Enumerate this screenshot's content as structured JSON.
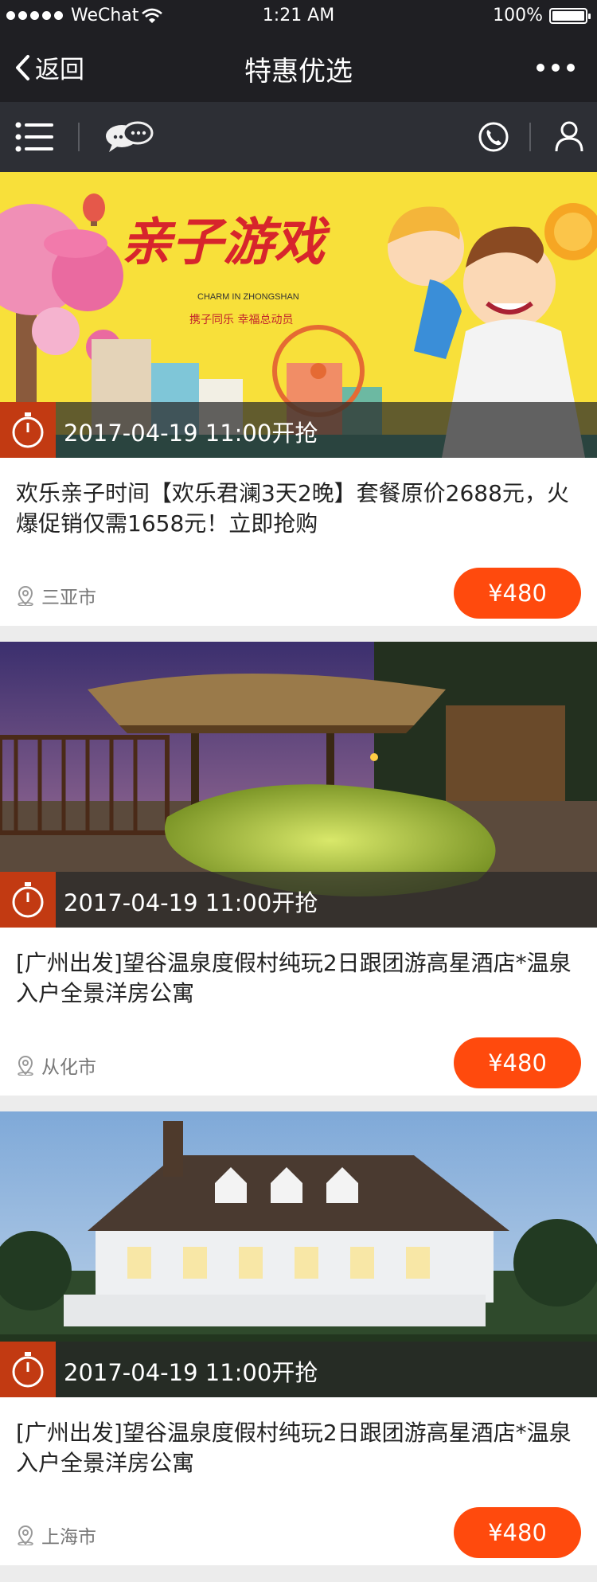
{
  "status_bar": {
    "carrier": "WeChat",
    "time": "1:21 AM",
    "battery": "100%"
  },
  "nav": {
    "back_label": "返回",
    "title": "特惠优选"
  },
  "cards": [
    {
      "banner": {
        "title": "亲子游戏",
        "subtitle": "CHARM IN ZHONGSHAN",
        "tagline": "携子同乐 幸福总动员"
      },
      "time": "2017-04-19  11:00开抢",
      "title": "欢乐亲子时间【欢乐君澜3天2晚】套餐原价2688元，火爆促销仅需1658元！立即抢购",
      "location": "三亚市",
      "price": "¥480"
    },
    {
      "time": "2017-04-19  11:00开抢",
      "title": "[广州出发]望谷温泉度假村纯玩2日跟团游高星酒店*温泉入户全景洋房公寓",
      "location": "从化市",
      "price": "¥480"
    },
    {
      "time": "2017-04-19  11:00开抢",
      "title": "[广州出发]望谷温泉度假村纯玩2日跟团游高星酒店*温泉入户全景洋房公寓",
      "location": "上海市",
      "price": "¥480"
    }
  ],
  "colors": {
    "accent": "#ff4a0d",
    "nav_bg": "#1f1f23",
    "toolbar_bg": "#2d2f35",
    "clock_bg": "#c23a12"
  }
}
